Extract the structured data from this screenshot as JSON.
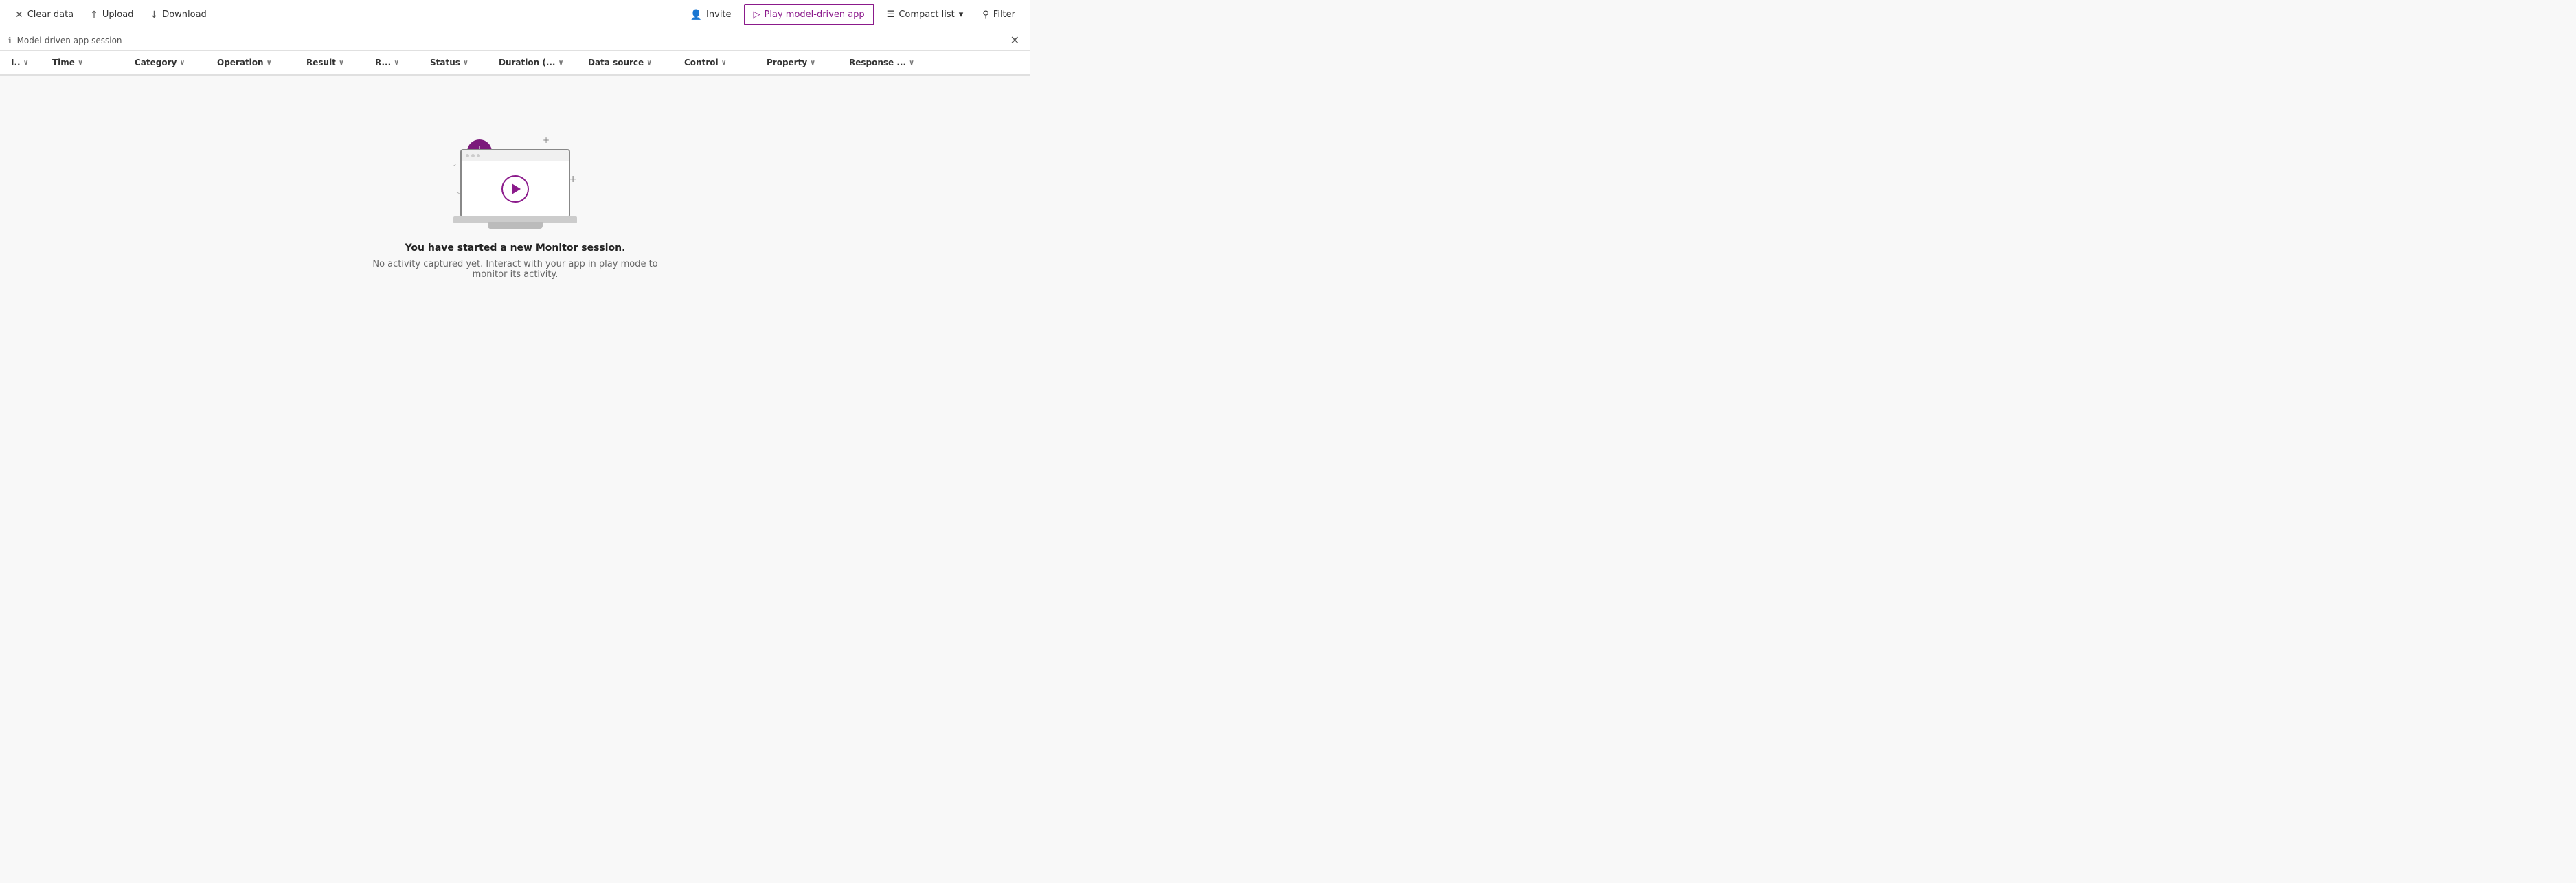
{
  "toolbar": {
    "clear_data_label": "Clear data",
    "upload_label": "Upload",
    "download_label": "Download",
    "invite_label": "Invite",
    "play_label": "Play model-driven app",
    "compact_list_label": "Compact list",
    "filter_label": "Filter"
  },
  "session_bar": {
    "icon": "ℹ",
    "label": "Model-driven app session",
    "close_icon": "✕"
  },
  "columns": [
    {
      "id": "col-id",
      "label": "I..",
      "has_chevron": true
    },
    {
      "id": "col-time",
      "label": "Time",
      "has_chevron": true
    },
    {
      "id": "col-category",
      "label": "Category",
      "has_chevron": true
    },
    {
      "id": "col-operation",
      "label": "Operation",
      "has_chevron": true
    },
    {
      "id": "col-result",
      "label": "Result",
      "has_chevron": true
    },
    {
      "id": "col-r",
      "label": "R...",
      "has_chevron": true
    },
    {
      "id": "col-status",
      "label": "Status",
      "has_chevron": true
    },
    {
      "id": "col-duration",
      "label": "Duration (...",
      "has_chevron": true
    },
    {
      "id": "col-datasource",
      "label": "Data source",
      "has_chevron": true
    },
    {
      "id": "col-control",
      "label": "Control",
      "has_chevron": true
    },
    {
      "id": "col-property",
      "label": "Property",
      "has_chevron": true
    },
    {
      "id": "col-response",
      "label": "Response ...",
      "has_chevron": true
    }
  ],
  "empty_state": {
    "title": "You have started a new Monitor session.",
    "subtitle": "No activity captured yet. Interact with your app in play mode to monitor its activity."
  },
  "colors": {
    "purple": "#8b1a8b",
    "purple_dark": "#7b1a7b",
    "border": "#e0e0e0",
    "text_dark": "#222222",
    "text_mid": "#555555",
    "text_light": "#666666"
  }
}
